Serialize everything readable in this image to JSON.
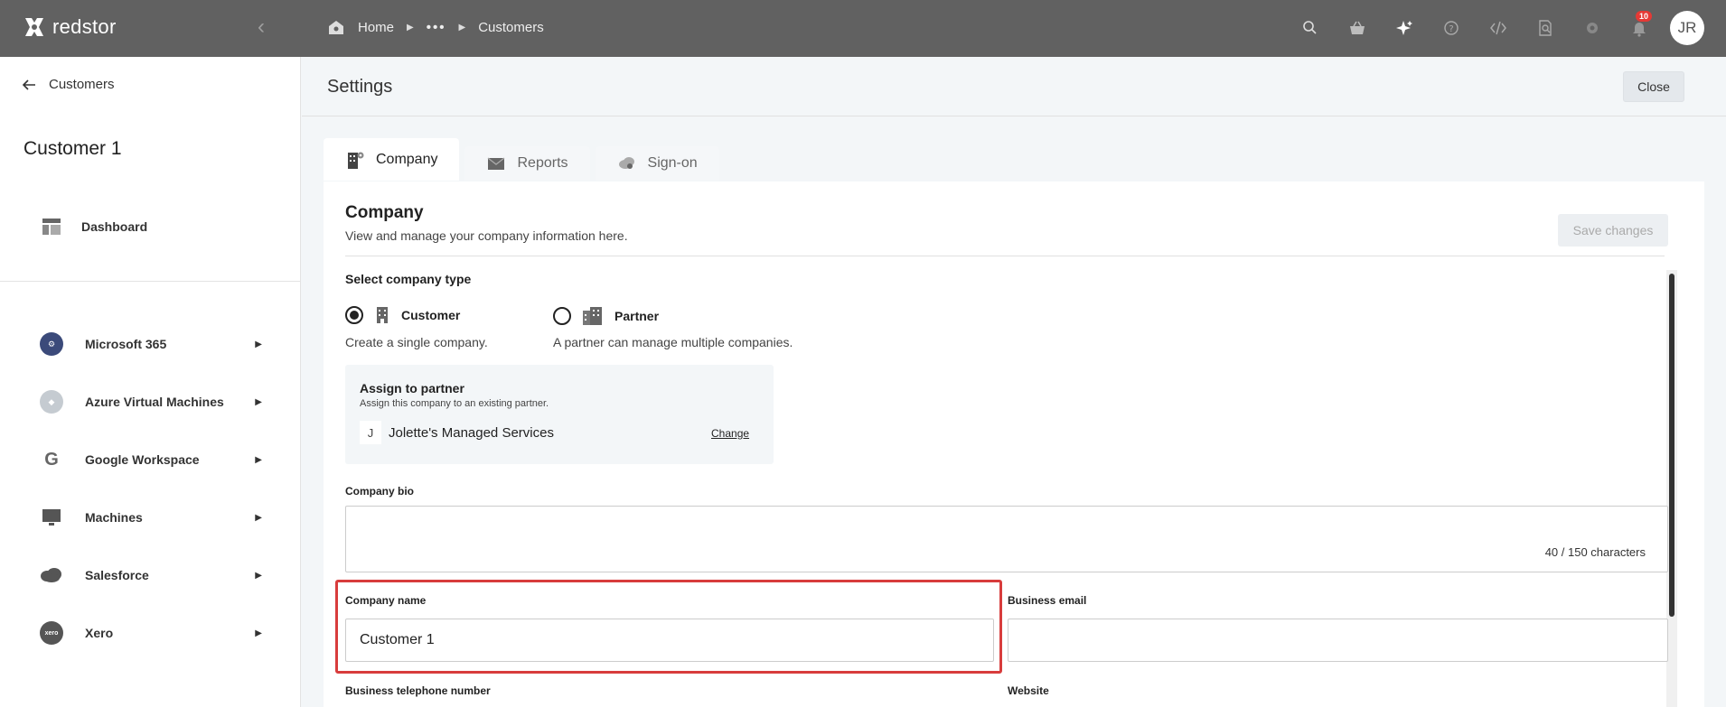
{
  "topbar": {
    "logo_text": "redstor",
    "breadcrumbs": {
      "home": "Home",
      "ellipsis": "•••",
      "current": "Customers"
    },
    "notification_count": "10",
    "avatar_initials": "JR",
    "icons": [
      "search-icon",
      "basket-icon",
      "sparkle-icon",
      "help-icon",
      "code-icon",
      "document-search-icon",
      "gear-icon",
      "bell-icon"
    ]
  },
  "sidebar": {
    "back_label": "Customers",
    "customer_title": "Customer 1",
    "dashboard_label": "Dashboard",
    "items": [
      {
        "label": "Microsoft 365",
        "icon": "microsoft-365-icon",
        "color": "#3b4a7a"
      },
      {
        "label": "Azure Virtual Machines",
        "icon": "azure-vm-icon",
        "color": "#9aa3ad"
      },
      {
        "label": "Google Workspace",
        "icon": "google-icon",
        "color": "#6b6b6b"
      },
      {
        "label": "Machines",
        "icon": "monitor-icon",
        "color": "#555555"
      },
      {
        "label": "Salesforce",
        "icon": "salesforce-icon",
        "color": "#555555"
      },
      {
        "label": "Xero",
        "icon": "xero-icon",
        "color": "#555555"
      }
    ]
  },
  "header": {
    "title": "Settings",
    "close_label": "Close"
  },
  "tabs": [
    {
      "label": "Company",
      "icon": "company-icon",
      "active": true
    },
    {
      "label": "Reports",
      "icon": "envelope-icon",
      "active": false
    },
    {
      "label": "Sign-on",
      "icon": "cloud-key-icon",
      "active": false
    }
  ],
  "company": {
    "title": "Company",
    "subtitle": "View and manage your company information here.",
    "save_label": "Save changes",
    "select_type_label": "Select company type",
    "type_customer": {
      "label": "Customer",
      "desc": "Create a single company.",
      "selected": true
    },
    "type_partner": {
      "label": "Partner",
      "desc": "A partner can manage multiple companies.",
      "selected": false
    },
    "partner": {
      "title": "Assign to partner",
      "subtitle": "Assign this company to an existing partner.",
      "initial": "J",
      "name": "Jolette's Managed Services",
      "change_label": "Change"
    },
    "bio_label": "Company bio",
    "bio_count": "40 / 150 characters",
    "name_label": "Company name",
    "name_value": "Customer 1",
    "email_label": "Business email",
    "email_value": "",
    "phone_label": "Business telephone number",
    "website_label": "Website"
  },
  "colors": {
    "topbar": "#616161",
    "highlight": "#d83c3c",
    "accent_badge": "#e53935"
  }
}
